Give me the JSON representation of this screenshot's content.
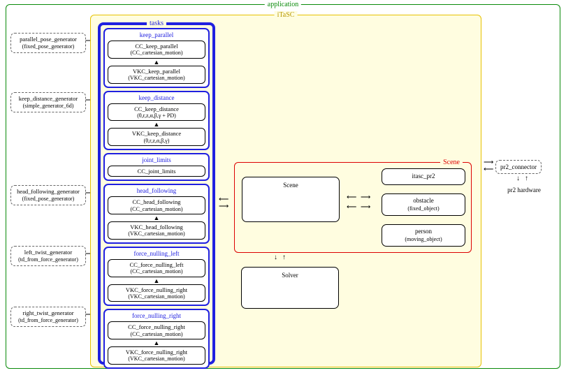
{
  "application_label": "application",
  "itasc_label": "iTaSC",
  "tasks_label": "tasks",
  "scene_label": "Scene",
  "generators": {
    "parallel": {
      "name": "parallel_pose_generator",
      "type": "(fixed_pose_generator)"
    },
    "keep_distance": {
      "name": "keep_distance_generator",
      "type": "(simple_generator_6d)"
    },
    "head_following": {
      "name": "head_following_generator",
      "type": "(fixed_pose_generator)"
    },
    "left_twist": {
      "name": "left_twist_generator",
      "type": "(td_from_force_generator)"
    },
    "right_twist": {
      "name": "right_twist_generator",
      "type": "(td_from_force_generator)"
    }
  },
  "tasks": {
    "keep_parallel": {
      "title": "keep_parallel",
      "cc": {
        "name": "CC_keep_parallel",
        "type": "(CC_cartesian_motion)"
      },
      "vkc": {
        "name": "VKC_keep_parallel",
        "type": "(VKC_cartesian_motion)"
      }
    },
    "keep_distance": {
      "title": "keep_distance",
      "cc": {
        "name": "CC_keep_distance",
        "type": "(θ,r,z,α,β,γ + PD)"
      },
      "vkc": {
        "name": "VKC_keep_distance",
        "type": "(θ,r,z,α,β,γ)"
      }
    },
    "joint_limits": {
      "title": "joint_limits",
      "cc": {
        "name": "CC_joint_limits"
      }
    },
    "head_following": {
      "title": "head_following",
      "cc": {
        "name": "CC_head_following",
        "type": "(CC_cartesian_motion)"
      },
      "vkc": {
        "name": "VKC_head_following",
        "type": "(VKC_cartesian_motion)"
      }
    },
    "force_nulling_left": {
      "title": "force_nulling_left",
      "cc": {
        "name": "CC_force_nulling_left",
        "type": "(CC_cartesian_motion)"
      },
      "vkc": {
        "name": "VKC_force_nulling_right",
        "type": "(VKC_cartesian_motion)"
      }
    },
    "force_nulling_right": {
      "title": "force_nulling_right",
      "cc": {
        "name": "CC_force_nulling_right",
        "type": "(CC_cartesian_motion)"
      },
      "vkc": {
        "name": "VKC_force_nulling_right",
        "type": "(VKC_cartesian_motion)"
      }
    }
  },
  "scene": {
    "scene_box": "Scene",
    "itasc_pr2": "itasc_pr2",
    "obstacle": {
      "name": "obstacle",
      "type": "(fixed_object)"
    },
    "person": {
      "name": "person",
      "type": "(moving_object)"
    }
  },
  "solver": "Solver",
  "pr2_connector": "pr2_connector",
  "pr2_hardware": "pr2 hardware"
}
